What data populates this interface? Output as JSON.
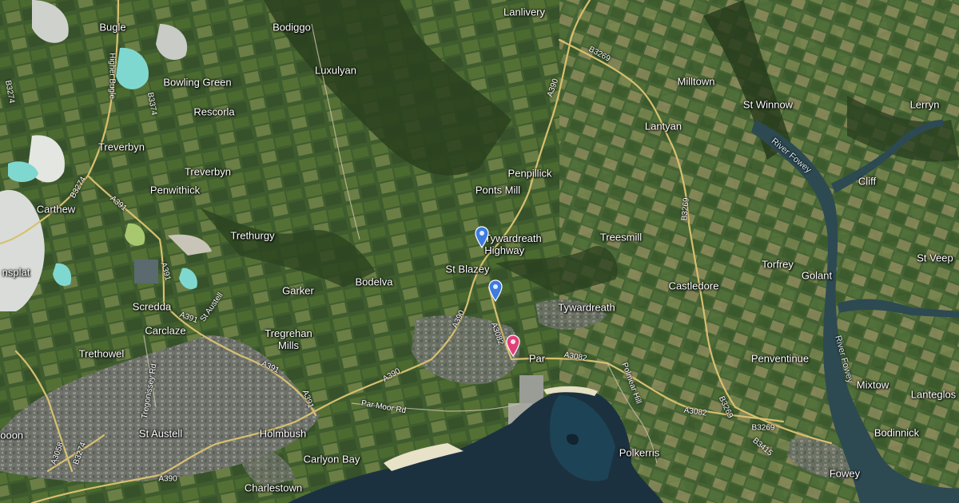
{
  "map": {
    "view": "satellite",
    "colors": {
      "land": "#3d5a2e",
      "field_light": "#6b7f45",
      "field_tan": "#8a8a5a",
      "woodland": "#2a3f1f",
      "sea": "#1c3140",
      "town": "#7d7f78",
      "clay_white": "#d9dcd8",
      "clay_pool": "#7fd8d0",
      "road": "#d8c070",
      "pin_blue": "#3d7be0",
      "pin_pink": "#e0407a"
    },
    "places": [
      {
        "name": "Lanlivery"
      },
      {
        "name": "Bugle"
      },
      {
        "name": "Bodiggo"
      },
      {
        "name": "Luxulyan"
      },
      {
        "name": "Bowling Green"
      },
      {
        "name": "Milltown"
      },
      {
        "name": "Rescorla"
      },
      {
        "name": "St Winnow"
      },
      {
        "name": "Lerryn"
      },
      {
        "name": "Lantyan"
      },
      {
        "name": "Treverbyn"
      },
      {
        "name": "Treverbyn"
      },
      {
        "name": "Penpillick"
      },
      {
        "name": "Cliff"
      },
      {
        "name": "Penwithick"
      },
      {
        "name": "Ponts Mill"
      },
      {
        "name": "Carthew"
      },
      {
        "name": "Tywardreath Highway"
      },
      {
        "name": "Treesmill"
      },
      {
        "name": "Trethurgy"
      },
      {
        "name": "St Veep"
      },
      {
        "name": "nsplat"
      },
      {
        "name": "St Blazey"
      },
      {
        "name": "Torfrey"
      },
      {
        "name": "Golant"
      },
      {
        "name": "Bodelva"
      },
      {
        "name": "Castledore"
      },
      {
        "name": "Garker"
      },
      {
        "name": "Scredda"
      },
      {
        "name": "Tywardreath"
      },
      {
        "name": "Tregrehan Mills"
      },
      {
        "name": "Carclaze"
      },
      {
        "name": "Trethowel"
      },
      {
        "name": "Par"
      },
      {
        "name": "Penventinue"
      },
      {
        "name": "Mixtow"
      },
      {
        "name": "Lanteglos"
      },
      {
        "name": "St Austell"
      },
      {
        "name": "Holmbush"
      },
      {
        "name": "Bodinnick"
      },
      {
        "name": "wooon"
      },
      {
        "name": "Polkerris"
      },
      {
        "name": "Carlyon Bay"
      },
      {
        "name": "Fowey"
      },
      {
        "name": "Charlestown"
      }
    ],
    "roads": [
      {
        "ref": "B3269"
      },
      {
        "ref": "A390"
      },
      {
        "ref": "Higher Bugle"
      },
      {
        "ref": "B3274"
      },
      {
        "ref": "B3374"
      },
      {
        "ref": "B3274"
      },
      {
        "ref": "A391"
      },
      {
        "ref": "A391"
      },
      {
        "ref": "B3269"
      },
      {
        "ref": "A391"
      },
      {
        "ref": "St Austell"
      },
      {
        "ref": "A391"
      },
      {
        "ref": "A391"
      },
      {
        "ref": "A390"
      },
      {
        "ref": "A390"
      },
      {
        "ref": "A3082"
      },
      {
        "ref": "A3082"
      },
      {
        "ref": "Polmear Hill"
      },
      {
        "ref": "Par Moor Rd"
      },
      {
        "ref": "Tregonissey Rd"
      },
      {
        "ref": "A3082"
      },
      {
        "ref": "B3269"
      },
      {
        "ref": "B3269"
      },
      {
        "ref": "B3415"
      },
      {
        "ref": "A3058"
      },
      {
        "ref": "B3274"
      },
      {
        "ref": "A390"
      }
    ],
    "rivers": [
      {
        "name": "River Fowey"
      },
      {
        "name": "River Fowey"
      }
    ],
    "markers": [
      {
        "icon": "map-pin-icon",
        "color": "blue"
      },
      {
        "icon": "map-pin-icon",
        "color": "blue"
      },
      {
        "icon": "map-pin-icon",
        "color": "pink"
      }
    ]
  }
}
